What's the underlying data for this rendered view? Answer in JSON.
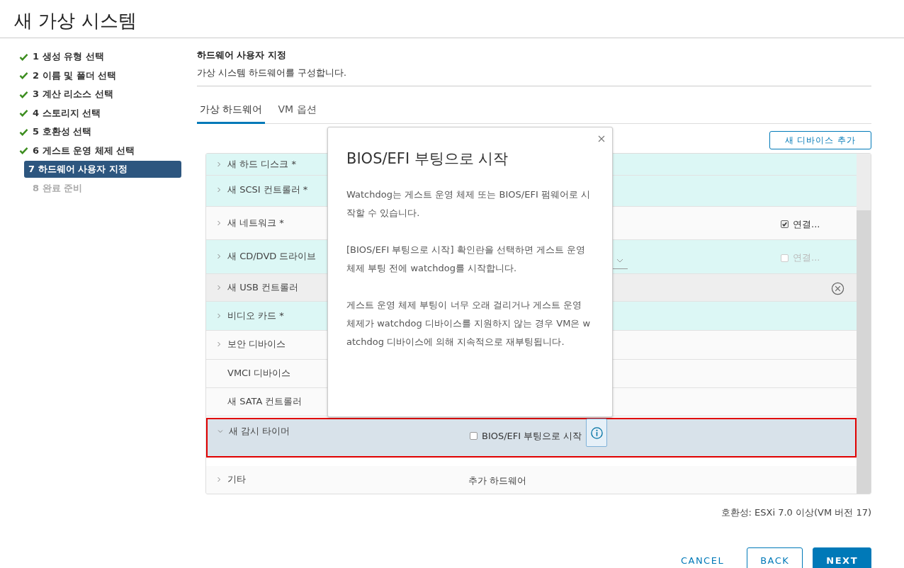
{
  "window": {
    "title": "새 가상 시스템"
  },
  "steps": [
    {
      "label": "1 생성 유형 선택",
      "done": true,
      "selected": false
    },
    {
      "label": "2 이름 및 폴더 선택",
      "done": true,
      "selected": false
    },
    {
      "label": "3 계산 리소스 선택",
      "done": true,
      "selected": false
    },
    {
      "label": "4 스토리지 선택",
      "done": true,
      "selected": false
    },
    {
      "label": "5 호환성 선택",
      "done": true,
      "selected": false
    },
    {
      "label": "6 게스트 운영 체제 선택",
      "done": true,
      "selected": false
    },
    {
      "label": "7 하드웨어 사용자 지정",
      "done": false,
      "selected": true
    },
    {
      "label": "8 완료 준비",
      "done": false,
      "selected": false
    }
  ],
  "page": {
    "heading": "하드웨어 사용자 지정",
    "subtitle": "가상 시스템 하드웨어를 구성합니다."
  },
  "tabs": [
    {
      "label": "가상 하드웨어",
      "selected": true
    },
    {
      "label": "VM 옵션",
      "selected": false
    }
  ],
  "add_device_button": "새 디바이스 추가",
  "devices": [
    {
      "name": "새 하드 디스크 *",
      "expandable": true,
      "expanded": false,
      "is_new": true,
      "hovered": false,
      "selected": false,
      "kind": "none"
    },
    {
      "name": "새 SCSI 컨트롤러 *",
      "expandable": true,
      "expanded": false,
      "is_new": true,
      "hovered": false,
      "selected": false,
      "kind": "none"
    },
    {
      "name": "새 네트워크 *",
      "expandable": true,
      "expanded": false,
      "is_new": false,
      "hovered": false,
      "selected": false,
      "kind": "connect",
      "checked": true,
      "disabled": false,
      "label": "연결..."
    },
    {
      "name": "새 CD/DVD 드라이브",
      "expandable": true,
      "expanded": false,
      "is_new": true,
      "hovered": false,
      "selected": false,
      "kind": "media",
      "checked": false,
      "disabled": true,
      "label": "연결..."
    },
    {
      "name": "새 USB 컨트롤러",
      "expandable": true,
      "expanded": false,
      "is_new": false,
      "hovered": true,
      "selected": false,
      "kind": "remove"
    },
    {
      "name": "비디오 카드 *",
      "expandable": true,
      "expanded": false,
      "is_new": true,
      "hovered": false,
      "selected": false,
      "kind": "none"
    },
    {
      "name": "보안 디바이스",
      "expandable": true,
      "expanded": false,
      "is_new": false,
      "hovered": false,
      "selected": false,
      "kind": "none"
    },
    {
      "name": "VMCI 디바이스",
      "expandable": false,
      "is_new": false,
      "hovered": false,
      "selected": false,
      "kind": "none"
    },
    {
      "name": "새 SATA 컨트롤러",
      "expandable": false,
      "is_new": false,
      "hovered": false,
      "selected": false,
      "kind": "none"
    },
    {
      "name": "새 감시 타이머",
      "expandable": true,
      "expanded": true,
      "is_new": false,
      "hovered": false,
      "selected": true,
      "kind": "boot",
      "checked": false,
      "label": "BIOS/EFI 부팅으로 시작"
    },
    {
      "name": "기타",
      "expandable": true,
      "expanded": false,
      "is_new": false,
      "hovered": false,
      "selected": false,
      "kind": "text",
      "value": "추가 하드웨어"
    }
  ],
  "popover": {
    "title": "BIOS/EFI 부팅으로 시작",
    "paragraphs": [
      "Watchdog는 게스트 운영 체제 또는 BIOS/EFI 펌웨어로 시작할 수 있습니다.",
      "[BIOS/EFI 부팅으로 시작] 확인란을 선택하면 게스트 운영 체제 부팅 전에 watchdog를 시작합니다.",
      "게스트 운영 체제 부팅이 너무 오래 걸리거나 게스트 운영 체제가 watchdog 디바이스를 지원하지 않는 경우 VM은 watchdog 디바이스에 의해 지속적으로 재부팅됩니다."
    ]
  },
  "compatibility": "호환성: ESXi 7.0 이상(VM 버전 17)",
  "buttons": [
    {
      "label": "CANCEL",
      "kind": "link"
    },
    {
      "label": "BACK",
      "kind": "outline"
    },
    {
      "label": "NEXT",
      "kind": "primary"
    }
  ]
}
